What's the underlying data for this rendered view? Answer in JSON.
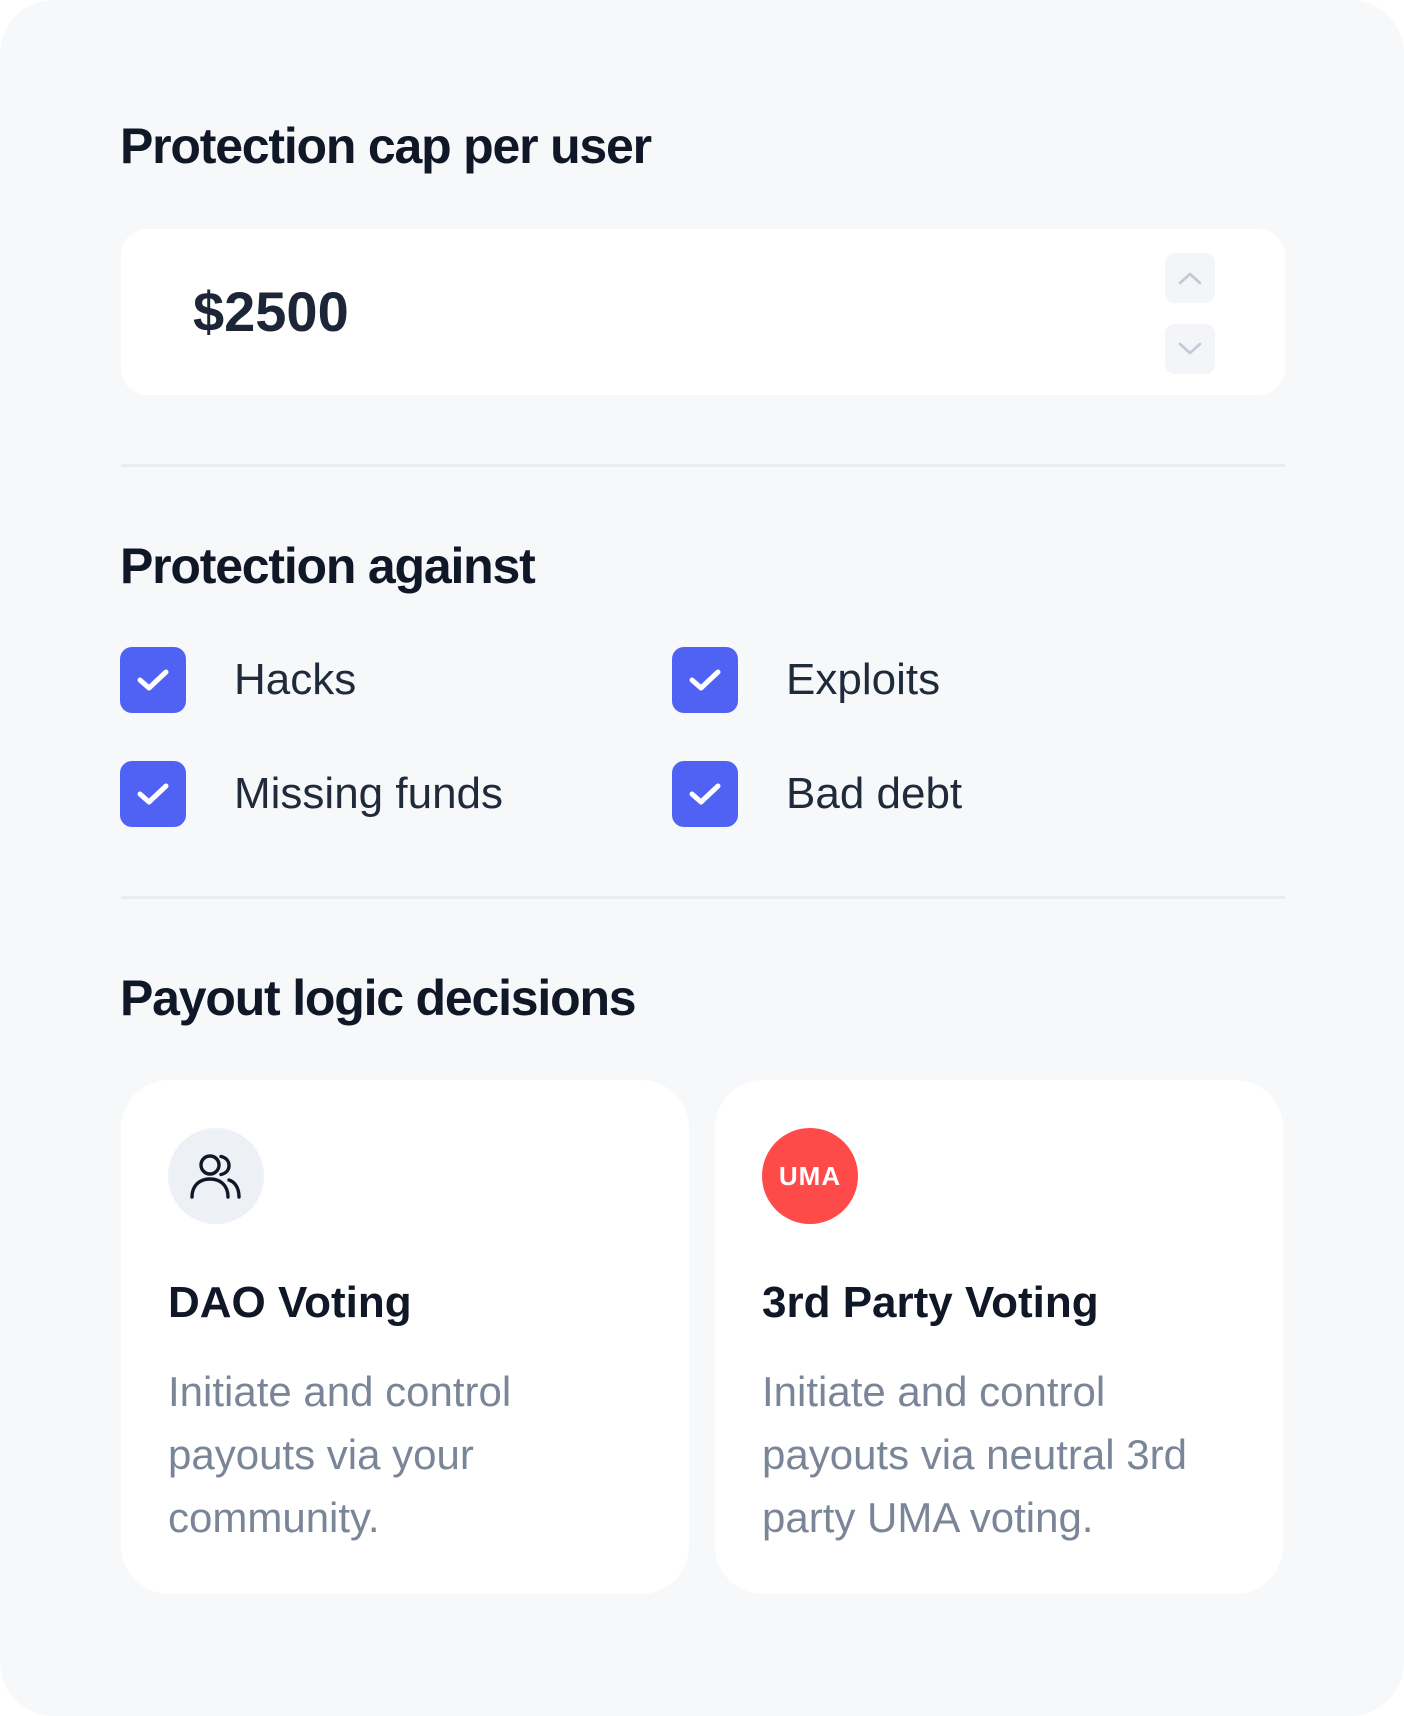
{
  "protection_cap": {
    "title": "Protection cap per user",
    "value": "$2500",
    "increment_icon": "chevron-up-icon",
    "decrement_icon": "chevron-down-icon"
  },
  "protection_against": {
    "title": "Protection against",
    "options": [
      {
        "label": "Hacks",
        "checked": true
      },
      {
        "label": "Exploits",
        "checked": true
      },
      {
        "label": "Missing funds",
        "checked": true
      },
      {
        "label": "Bad debt",
        "checked": true
      }
    ]
  },
  "payout_logic": {
    "title": "Payout logic decisions",
    "cards": [
      {
        "icon": "users-icon",
        "title": "DAO Voting",
        "description": "Initiate and control payouts via your community."
      },
      {
        "icon": "uma-logo",
        "logo_text": "UMA",
        "title": "3rd Party Voting",
        "description": "Initiate and control payouts via neutral 3rd party UMA voting."
      }
    ]
  },
  "colors": {
    "background": "#f7f8fa",
    "card": "#ffffff",
    "checkbox": "#5062f3",
    "uma_red": "#ff4a4a",
    "heading": "#101828",
    "muted_text": "#7a8698"
  }
}
